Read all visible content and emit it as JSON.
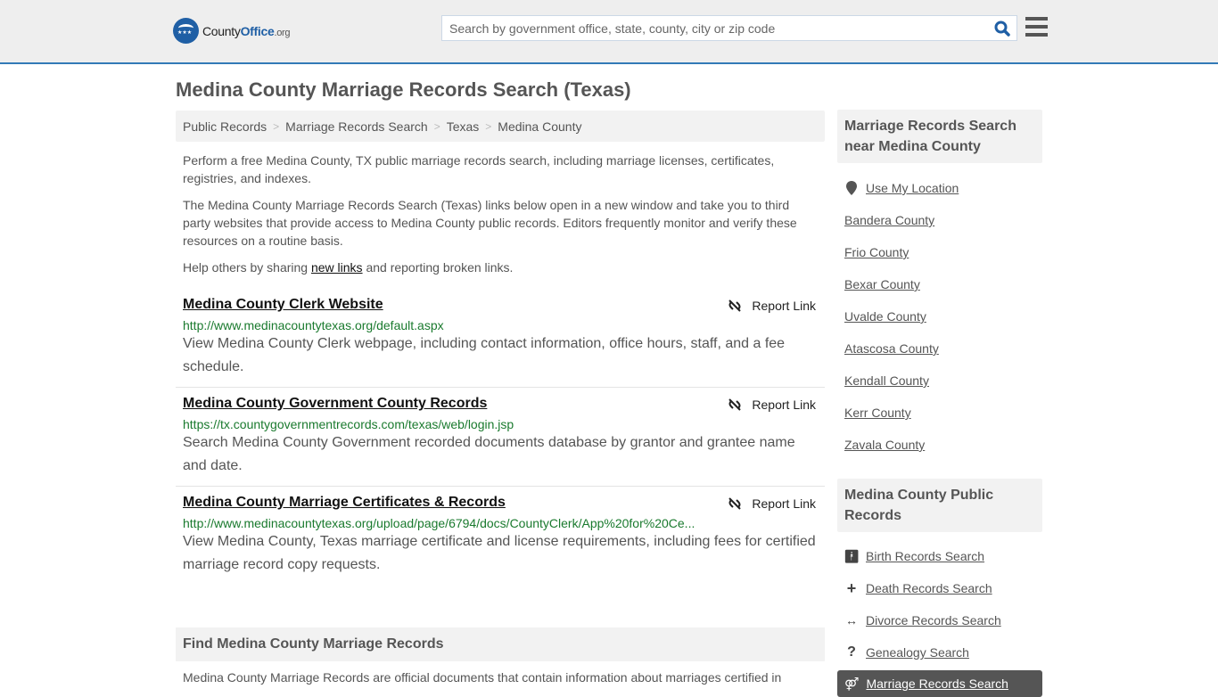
{
  "header": {
    "logo": {
      "part1": "County",
      "part2": "Office",
      "part3": ".org"
    },
    "search_placeholder": "Search by government office, state, county, city or zip code",
    "search_value": ""
  },
  "page_title": "Medina County Marriage Records Search (Texas)",
  "breadcrumb": [
    "Public Records",
    "Marriage Records Search",
    "Texas",
    "Medina County"
  ],
  "intro": {
    "p1": "Perform a free Medina County, TX public marriage records search, including marriage licenses, certificates, registries, and indexes.",
    "p2": "The Medina County Marriage Records Search (Texas) links below open in a new window and take you to third party websites that provide access to Medina County public records. Editors frequently monitor and verify these resources on a routine basis.",
    "p3_before": "Help others by sharing ",
    "p3_link": "new links",
    "p3_after": " and reporting broken links."
  },
  "results": [
    {
      "title": "Medina County Clerk Website",
      "url": "http://www.medinacountytexas.org/default.aspx",
      "desc": "View Medina County Clerk webpage, including contact information, office hours, staff, and a fee schedule.",
      "report": "Report Link"
    },
    {
      "title": "Medina County Government County Records",
      "url": "https://tx.countygovernmentrecords.com/texas/web/login.jsp",
      "desc": "Search Medina County Government recorded documents database by grantor and grantee name and date.",
      "report": "Report Link"
    },
    {
      "title": "Medina County Marriage Certificates & Records",
      "url": "http://www.medinacountytexas.org/upload/page/6794/docs/CountyClerk/App%20for%20Ce...",
      "desc": "View Medina County, Texas marriage certificate and license requirements, including fees for certified marriage record copy requests.",
      "report": "Report Link"
    }
  ],
  "find_section": {
    "heading": "Find Medina County Marriage Records",
    "text": "Medina County Marriage Records are official documents that contain information about marriages certified in"
  },
  "sidebar": {
    "nearby_heading": "Marriage Records Search near Medina County",
    "use_location": "Use My Location",
    "nearby": [
      "Bandera County",
      "Frio County",
      "Bexar County",
      "Uvalde County",
      "Atascosa County",
      "Kendall County",
      "Kerr County",
      "Zavala County"
    ],
    "public_heading": "Medina County Public Records",
    "public_items": [
      {
        "label": "Birth Records Search",
        "icon": "child-icon"
      },
      {
        "label": "Death Records Search",
        "icon": "plus-icon"
      },
      {
        "label": "Divorce Records Search",
        "icon": "arrows-horizontal-icon"
      },
      {
        "label": "Genealogy Search",
        "icon": "question-icon"
      }
    ],
    "active_item": {
      "label": "Marriage Records Search",
      "icon": "marriage-icon"
    }
  }
}
